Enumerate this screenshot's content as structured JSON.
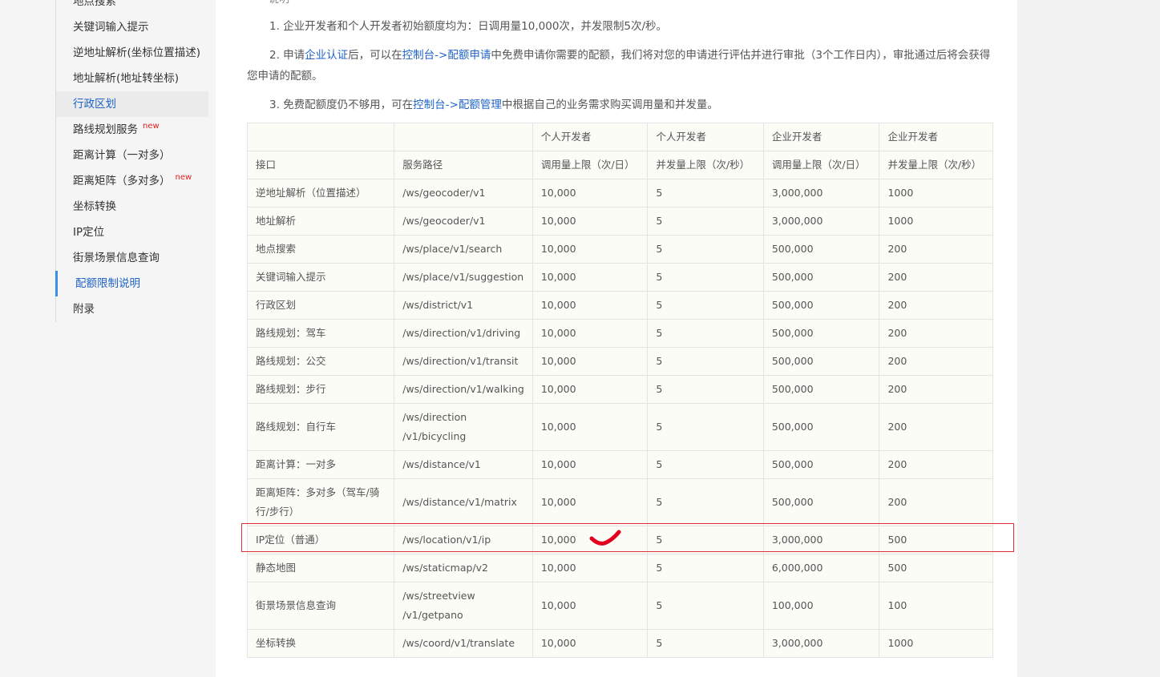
{
  "sidebar": {
    "items": [
      {
        "label": "地点搜索"
      },
      {
        "label": "关键词输入提示"
      },
      {
        "label": "逆地址解析(坐标位置描述)"
      },
      {
        "label": "地址解析(地址转坐标)"
      },
      {
        "label": "行政区划"
      },
      {
        "label": "路线规划服务",
        "badge": "new"
      },
      {
        "label": "距离计算（一对多）"
      },
      {
        "label": "距离矩阵（多对多）",
        "badge": "new"
      },
      {
        "label": "坐标转换"
      },
      {
        "label": "IP定位"
      },
      {
        "label": "街景场景信息查询"
      },
      {
        "label": "配额限制说明"
      },
      {
        "label": "附录"
      }
    ]
  },
  "main": {
    "top_cut": "说明",
    "note1": "1. 企业开发者和个人开发者初始额度均为：日调用量10,000次，并发限制5次/秒。",
    "note2": {
      "p1": "2. 申请",
      "link1": "企业认证",
      "p2": "后，可以在",
      "link2": "控制台->配额申请",
      "p3": "中免费申请你需要的配额，我们将对您的申请进行评估并进行审批（3个工作日内），审批通过后将会获得您申请的配额。"
    },
    "note3": {
      "p1": "3. 免费配额度仍不够用，可在",
      "link1": "控制台->配额管理",
      "p2": "中根据自己的业务需求购买调用量和并发量。"
    }
  },
  "table": {
    "group_header": [
      "",
      "",
      "个人开发者",
      "个人开发者",
      "企业开发者",
      "企业开发者"
    ],
    "header": [
      "接口",
      "服务路径",
      "调用量上限（次/日）",
      "并发量上限（次/秒）",
      "调用量上限（次/日）",
      "并发量上限（次/秒）"
    ],
    "rows": [
      [
        "逆地址解析（位置描述）",
        "/ws/geocoder/v1",
        "10,000",
        "5",
        "3,000,000",
        "1000"
      ],
      [
        "地址解析",
        "/ws/geocoder/v1",
        "10,000",
        "5",
        "3,000,000",
        "1000"
      ],
      [
        "地点搜索",
        "/ws/place/v1/search",
        "10,000",
        "5",
        "500,000",
        "200"
      ],
      [
        "关键词输入提示",
        "/ws/place/v1/suggestion",
        "10,000",
        "5",
        "500,000",
        "200"
      ],
      [
        "行政区划",
        "/ws/district/v1",
        "10,000",
        "5",
        "500,000",
        "200"
      ],
      [
        "路线规划：驾车",
        "/ws/direction/v1/driving",
        "10,000",
        "5",
        "500,000",
        "200"
      ],
      [
        "路线规划：公交",
        "/ws/direction/v1/transit",
        "10,000",
        "5",
        "500,000",
        "200"
      ],
      [
        "路线规划：步行",
        "/ws/direction/v1/walking",
        "10,000",
        "5",
        "500,000",
        "200"
      ],
      [
        "路线规划：自行车",
        "/ws/direction /v1/bicycling",
        "10,000",
        "5",
        "500,000",
        "200"
      ],
      [
        "距离计算：一对多",
        "/ws/distance/v1",
        "10,000",
        "5",
        "500,000",
        "200"
      ],
      [
        "距离矩阵：多对多（驾车/骑行/步行）",
        "/ws/distance/v1/matrix",
        "10,000",
        "5",
        "500,000",
        "200"
      ],
      [
        "IP定位（普通）",
        "/ws/location/v1/ip",
        "10,000",
        "5",
        "3,000,000",
        "500"
      ],
      [
        "静态地图",
        "/ws/staticmap/v2",
        "10,000",
        "5",
        "6,000,000",
        "500"
      ],
      [
        "街景场景信息查询",
        "/ws/streetview /v1/getpano",
        "10,000",
        "5",
        "100,000",
        "100"
      ],
      [
        "坐标转换",
        "/ws/coord/v1/translate",
        "10,000",
        "5",
        "3,000,000",
        "1000"
      ]
    ],
    "tall_rows": [
      8,
      10,
      13
    ]
  },
  "annotation": {
    "highlight_color": "#e0303a",
    "check_color": "#e3001f"
  }
}
